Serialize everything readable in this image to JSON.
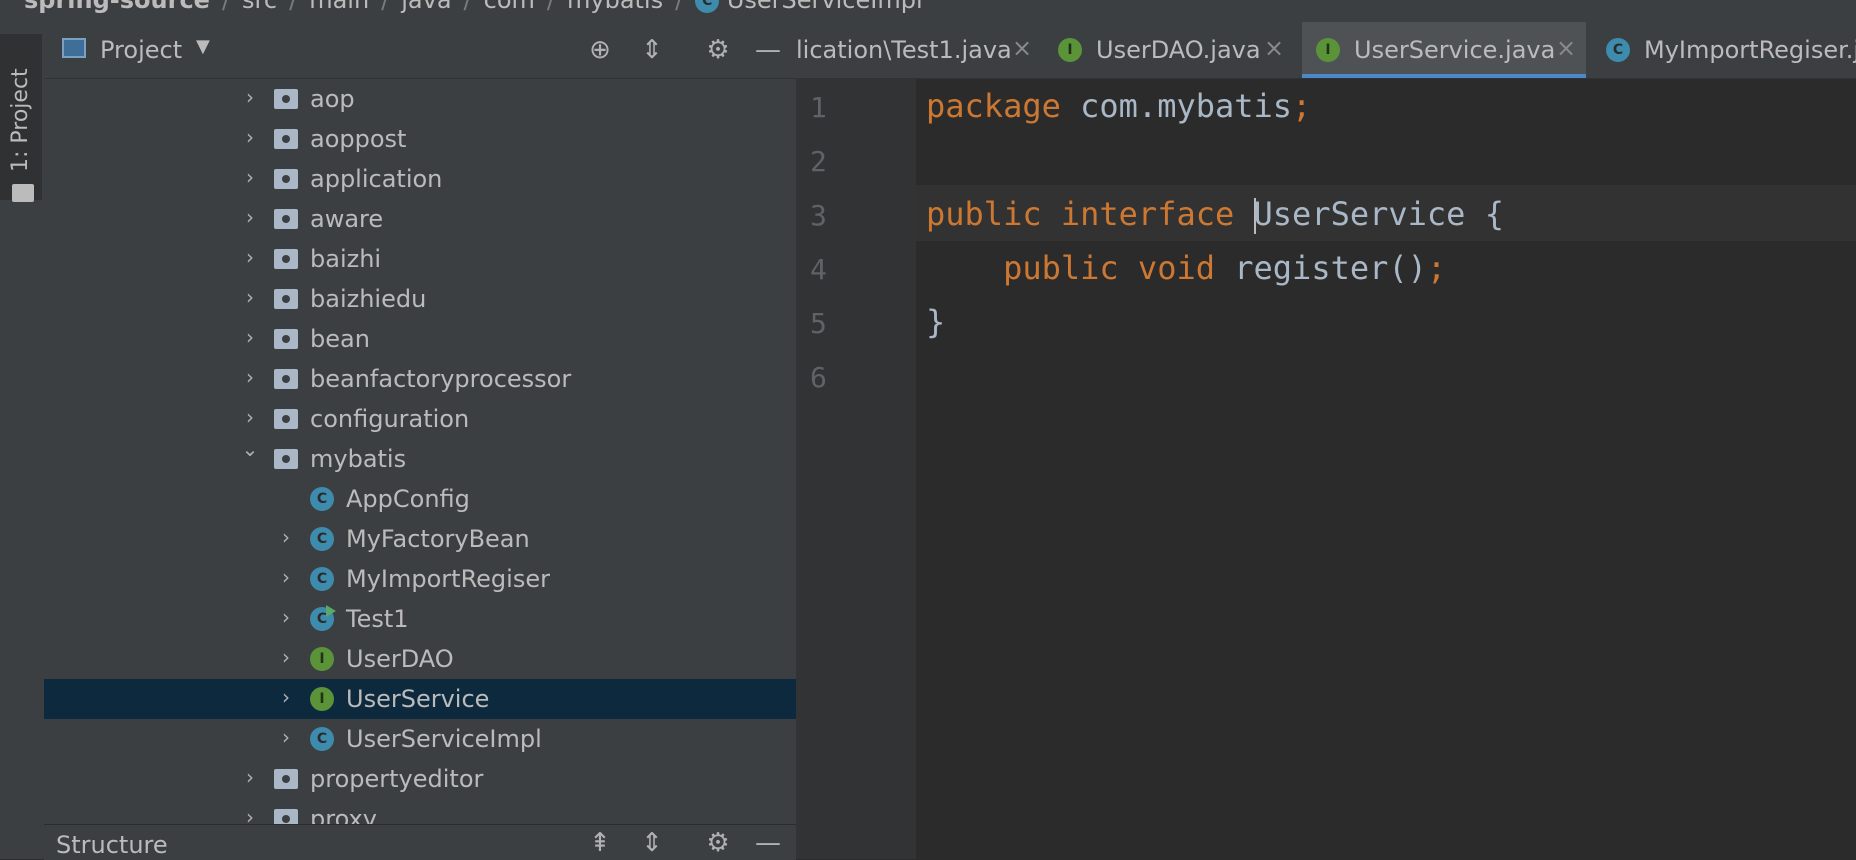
{
  "breadcrumb": {
    "project": "spring-source",
    "parts": [
      "src",
      "main",
      "java",
      "com",
      "mybatis"
    ],
    "file": "UserServiceImpl"
  },
  "left_strip": {
    "project_tab": "1: Project"
  },
  "project_panel": {
    "title": "Project",
    "tree": [
      {
        "label": "aop",
        "type": "folder",
        "expanded": false,
        "depth": 0
      },
      {
        "label": "aoppost",
        "type": "folder",
        "expanded": false,
        "depth": 0
      },
      {
        "label": "application",
        "type": "folder",
        "expanded": false,
        "depth": 0
      },
      {
        "label": "aware",
        "type": "folder",
        "expanded": false,
        "depth": 0
      },
      {
        "label": "baizhi",
        "type": "folder",
        "expanded": false,
        "depth": 0
      },
      {
        "label": "baizhiedu",
        "type": "folder",
        "expanded": false,
        "depth": 0
      },
      {
        "label": "bean",
        "type": "folder",
        "expanded": false,
        "depth": 0
      },
      {
        "label": "beanfactoryprocessor",
        "type": "folder",
        "expanded": false,
        "depth": 0
      },
      {
        "label": "configuration",
        "type": "folder",
        "expanded": false,
        "depth": 0
      },
      {
        "label": "mybatis",
        "type": "folder",
        "expanded": true,
        "depth": 0
      },
      {
        "label": "AppConfig",
        "type": "class",
        "expandable": false,
        "depth": 1
      },
      {
        "label": "MyFactoryBean",
        "type": "class",
        "expandable": true,
        "depth": 1
      },
      {
        "label": "MyImportRegiser",
        "type": "class",
        "expandable": true,
        "depth": 1
      },
      {
        "label": "Test1",
        "type": "runnable-class",
        "expandable": true,
        "depth": 1
      },
      {
        "label": "UserDAO",
        "type": "interface",
        "expandable": true,
        "depth": 1
      },
      {
        "label": "UserService",
        "type": "interface",
        "expandable": true,
        "depth": 1,
        "selected": true
      },
      {
        "label": "UserServiceImpl",
        "type": "class",
        "expandable": true,
        "depth": 1
      },
      {
        "label": "propertyeditor",
        "type": "folder",
        "expanded": false,
        "depth": 0
      },
      {
        "label": "proxy",
        "type": "folder",
        "expanded": false,
        "depth": 0
      }
    ]
  },
  "structure_panel": {
    "title": "Structure"
  },
  "editor": {
    "tabs": [
      {
        "label": "lication\\Test1.java",
        "icon": "none",
        "active": false
      },
      {
        "label": "UserDAO.java",
        "icon": "interface",
        "active": false
      },
      {
        "label": "UserService.java",
        "icon": "interface",
        "active": true
      },
      {
        "label": "MyImportRegiser.ja",
        "icon": "class",
        "active": false
      }
    ],
    "line_numbers": [
      "1",
      "2",
      "3",
      "4",
      "5",
      "6"
    ],
    "code": {
      "l1_kw": "package",
      "l1_rest": " com.mybatis",
      "l1_semi": ";",
      "l3_kw1": "public",
      "l3_kw2": "interface",
      "l3_name": "UserService",
      "l3_rest": " {",
      "l4_kw1": "public",
      "l4_kw2": "void",
      "l4_rest": " register()",
      "l4_semi": ";",
      "l5": "}"
    }
  }
}
